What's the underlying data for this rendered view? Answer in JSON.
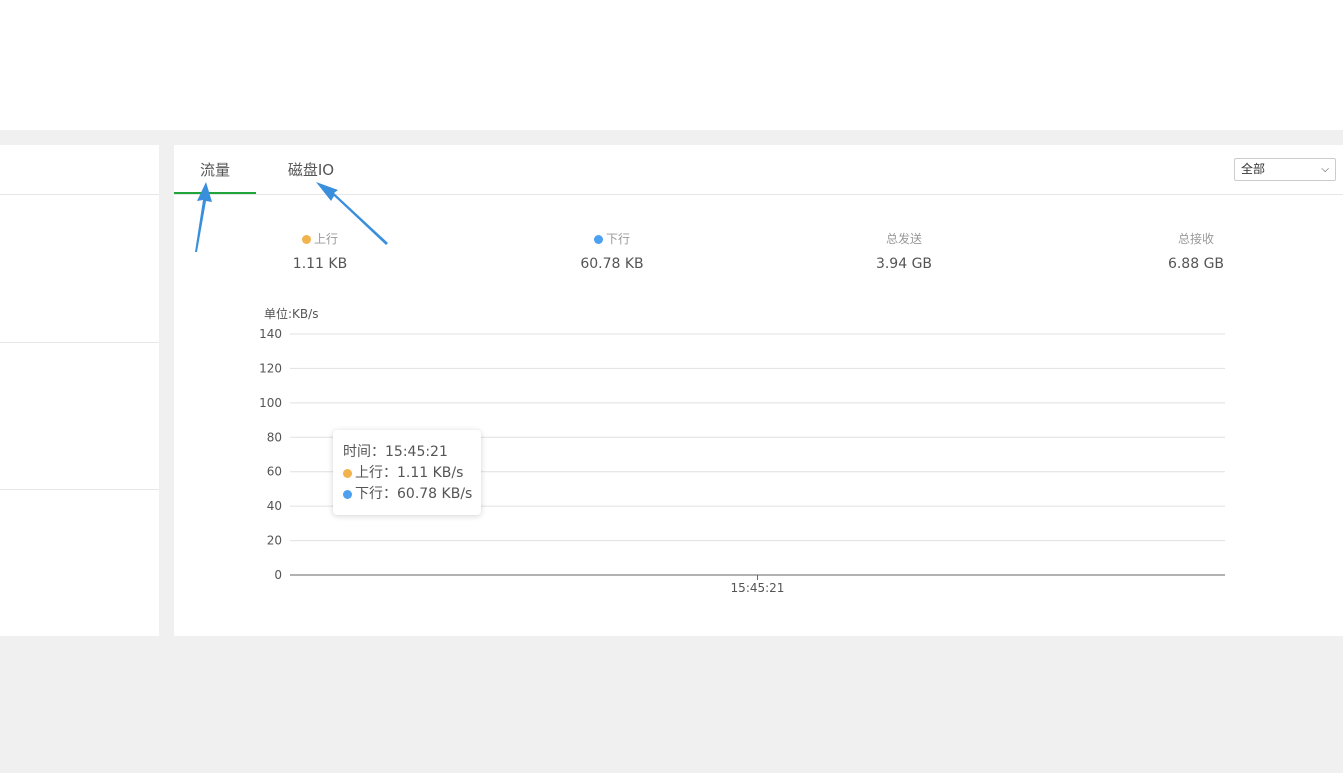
{
  "tabs": [
    {
      "label": "流量",
      "active": true
    },
    {
      "label": "磁盘IO",
      "active": false
    }
  ],
  "filter": {
    "selected": "全部"
  },
  "stats": {
    "up": {
      "label": "上行",
      "value": "1.11 KB",
      "color": "#f0b34d"
    },
    "down": {
      "label": "下行",
      "value": "60.78 KB",
      "color": "#4da0f0"
    },
    "total_sent": {
      "label": "总发送",
      "value": "3.94 GB"
    },
    "total_recv": {
      "label": "总接收",
      "value": "6.88 GB"
    }
  },
  "chart_data": {
    "type": "line",
    "ylabel": "单位:KB/s",
    "ylim": [
      0,
      140
    ],
    "yticks": [
      "0",
      "20",
      "40",
      "60",
      "80",
      "100",
      "120",
      "140"
    ],
    "categories": [
      "15:45:21"
    ],
    "series": [
      {
        "name": "上行",
        "values": [
          1.11
        ],
        "color": "#f0b34d"
      },
      {
        "name": "下行",
        "values": [
          60.78
        ],
        "color": "#4da0f0"
      }
    ],
    "grid": true
  },
  "tooltip": {
    "time": "时间：15:45:21",
    "up": "上行：1.11 KB/s",
    "down": "下行：60.78 KB/s"
  },
  "colors": {
    "accent": "#20a53a",
    "annotation_arrow": "#3a8fdc"
  }
}
